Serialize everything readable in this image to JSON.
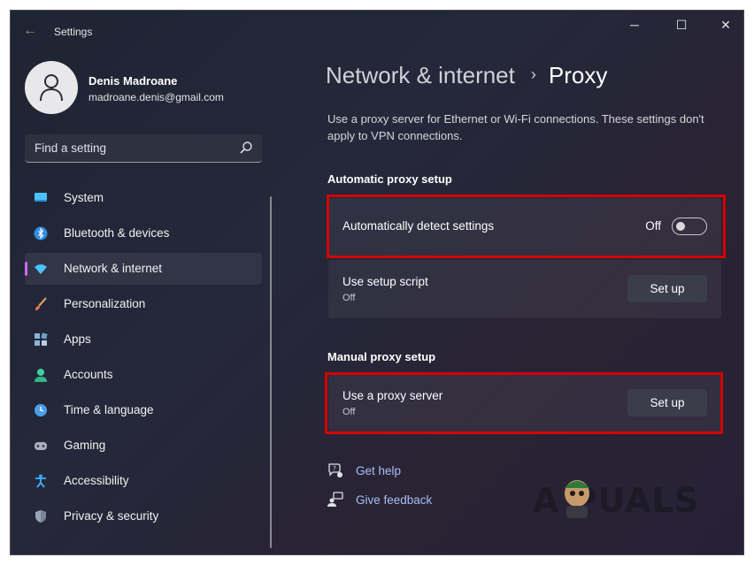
{
  "window": {
    "title": "Settings",
    "controls": {
      "minimize": "─",
      "maximize": "☐",
      "close": "✕"
    }
  },
  "user": {
    "name": "Denis Madroane",
    "email": "madroane.denis@gmail.com"
  },
  "search": {
    "placeholder": "Find a setting"
  },
  "sidebar": {
    "items": [
      {
        "label": "System",
        "icon": "system-icon",
        "active": false
      },
      {
        "label": "Bluetooth & devices",
        "icon": "bluetooth-icon",
        "active": false
      },
      {
        "label": "Network & internet",
        "icon": "wifi-icon",
        "active": true
      },
      {
        "label": "Personalization",
        "icon": "brush-icon",
        "active": false
      },
      {
        "label": "Apps",
        "icon": "apps-icon",
        "active": false
      },
      {
        "label": "Accounts",
        "icon": "accounts-icon",
        "active": false
      },
      {
        "label": "Time & language",
        "icon": "clock-globe-icon",
        "active": false
      },
      {
        "label": "Gaming",
        "icon": "gamepad-icon",
        "active": false
      },
      {
        "label": "Accessibility",
        "icon": "accessibility-icon",
        "active": false
      },
      {
        "label": "Privacy & security",
        "icon": "shield-icon",
        "active": false
      }
    ]
  },
  "breadcrumb": {
    "parent": "Network & internet",
    "separator": "›",
    "current": "Proxy"
  },
  "description": "Use a proxy server for Ethernet or Wi-Fi connections. These settings don't apply to VPN connections.",
  "automatic": {
    "heading": "Automatic proxy setup",
    "detect": {
      "title": "Automatically detect settings",
      "state_label": "Off",
      "on": false
    },
    "script": {
      "title": "Use setup script",
      "status": "Off",
      "button": "Set up"
    }
  },
  "manual": {
    "heading": "Manual proxy setup",
    "proxy": {
      "title": "Use a proxy server",
      "status": "Off",
      "button": "Set up"
    }
  },
  "links": {
    "help": "Get help",
    "feedback": "Give feedback"
  },
  "watermark": {
    "text": "A  PUALS"
  },
  "colors": {
    "accent": "#c76cf0",
    "highlight_box": "#d50000",
    "link": "#a7bff7"
  }
}
